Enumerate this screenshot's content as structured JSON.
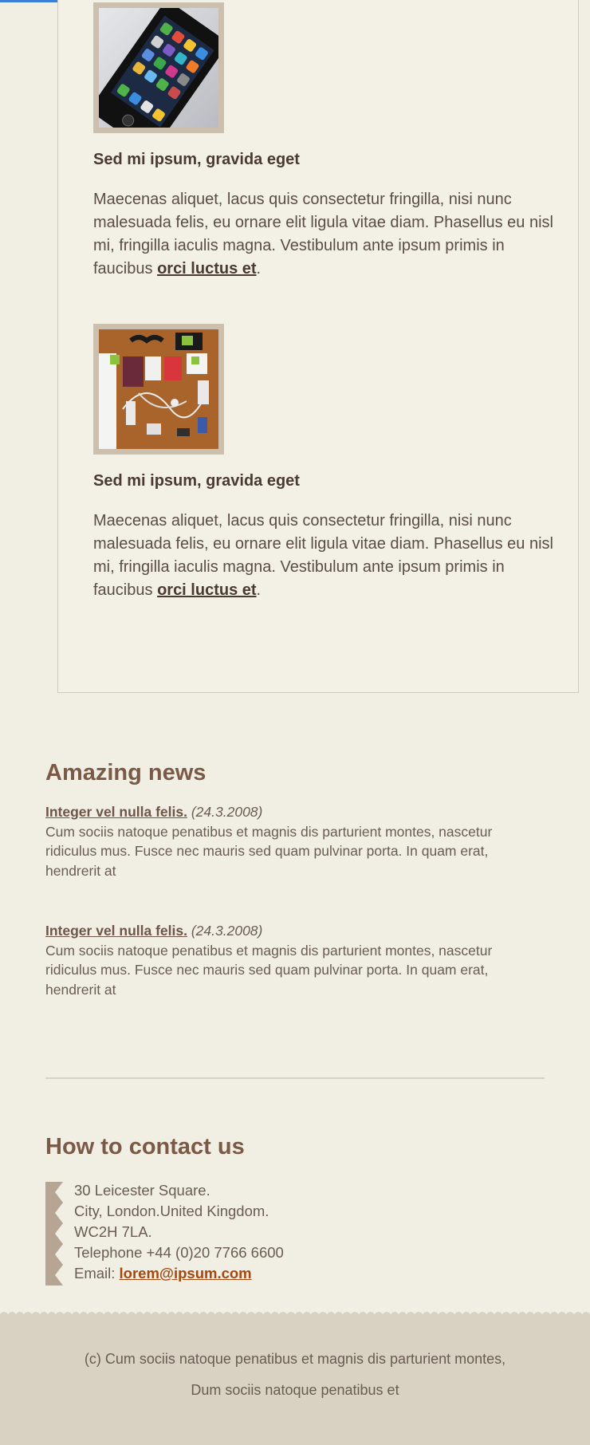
{
  "articles": [
    {
      "image": "smartphone-photo",
      "title": "Sed mi ipsum, gravida eget",
      "body": "Maecenas aliquet, lacus quis consectetur fringilla, nisi nunc malesuada felis, eu ornare elit ligula vitae diam. Phasellus eu nisl mi, fringilla iaculis magna. Vestibulum ante ipsum primis in faucibus ",
      "link": "orci luctus et",
      "end": "."
    },
    {
      "image": "gadgets-photo",
      "title": "Sed mi ipsum, gravida eget",
      "body": "Maecenas aliquet, lacus quis consectetur fringilla, nisi nunc malesuada felis, eu ornare elit ligula vitae diam. Phasellus eu nisl mi, fringilla iaculis magna. Vestibulum ante ipsum primis in faucibus ",
      "link": "orci luctus et",
      "end": "."
    }
  ],
  "news": {
    "heading": "Amazing news",
    "items": [
      {
        "link": "Integer vel nulla felis.",
        "date": "(24.3.2008)",
        "text": "Cum sociis natoque penatibus et magnis dis parturient montes, nascetur ridiculus mus. Fusce nec mauris sed quam pulvinar porta. In quam erat, hendrerit at"
      },
      {
        "link": "Integer vel nulla felis.",
        "date": "(24.3.2008)",
        "text": "Cum sociis natoque penatibus et magnis dis parturient montes, nascetur ridiculus mus. Fusce nec mauris sed quam pulvinar porta. In quam erat, hendrerit at"
      }
    ]
  },
  "contact": {
    "heading": "How to contact us",
    "lines": [
      "30 Leicester Square.",
      "City, London.United Kingdom.",
      "WC2H 7LA.",
      "Telephone +44 (0)20 7766 6600"
    ],
    "email_label": "Email: ",
    "email": "lorem@ipsum.com"
  },
  "footer": {
    "line1": "(c) Cum sociis natoque penatibus et magnis dis parturient montes,",
    "line2": "Dum sociis natoque penatibus et"
  },
  "colors": {
    "background": "#f1efe3",
    "heading": "#7a5a47",
    "footer": "#d9d1c1",
    "email_link": "#a54710",
    "top_bar": "#3a7fd5"
  }
}
